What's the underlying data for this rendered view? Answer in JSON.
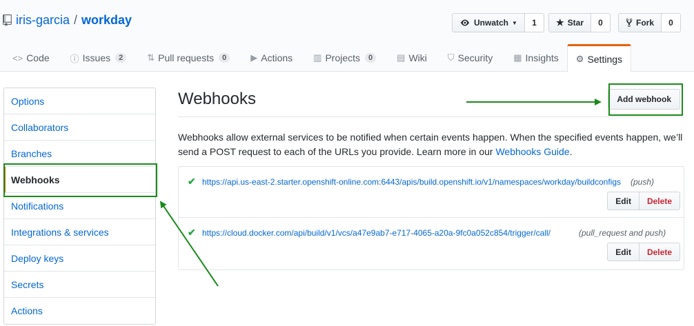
{
  "repo": {
    "owner": "iris-garcia",
    "separator": "/",
    "name": "workday"
  },
  "actions": {
    "watch": {
      "label": "Unwatch",
      "count": "1"
    },
    "star": {
      "label": "Star",
      "count": "0"
    },
    "fork": {
      "label": "Fork",
      "count": "0"
    }
  },
  "tabs": [
    {
      "icon": "code-icon",
      "label": "Code"
    },
    {
      "icon": "issue-icon",
      "label": "Issues",
      "count": "2"
    },
    {
      "icon": "pull-request-icon",
      "label": "Pull requests",
      "count": "0"
    },
    {
      "icon": "play-icon",
      "label": "Actions"
    },
    {
      "icon": "project-icon",
      "label": "Projects",
      "count": "0"
    },
    {
      "icon": "book-icon",
      "label": "Wiki"
    },
    {
      "icon": "shield-icon",
      "label": "Security"
    },
    {
      "icon": "graph-icon",
      "label": "Insights"
    },
    {
      "icon": "gear-icon",
      "label": "Settings"
    }
  ],
  "sidebar": {
    "items": [
      {
        "label": "Options"
      },
      {
        "label": "Collaborators"
      },
      {
        "label": "Branches"
      },
      {
        "label": "Webhooks"
      },
      {
        "label": "Notifications"
      },
      {
        "label": "Integrations & services"
      },
      {
        "label": "Deploy keys"
      },
      {
        "label": "Secrets"
      },
      {
        "label": "Actions"
      }
    ],
    "selected": "Webhooks"
  },
  "main": {
    "title": "Webhooks",
    "add_button": "Add webhook",
    "description_1": "Webhooks allow external services to be notified when certain events happen. When the specified events happen, we’ll send a POST request to each of the URLs you provide. Learn more in our ",
    "description_link": "Webhooks Guide",
    "description_2": ".",
    "hooks": [
      {
        "url": "https://api.us-east-2.starter.openshift-online.com:6443/apis/build.openshift.io/v1/namespaces/workday/buildconfigs",
        "events": "(push)",
        "edit": "Edit",
        "delete": "Delete"
      },
      {
        "url": "https://cloud.docker.com/api/build/v1/vcs/a47e9ab7-e717-4065-a20a-9fc0a052c854/trigger/call/",
        "events": "(pull_request and push)",
        "edit": "Edit",
        "delete": "Delete"
      }
    ]
  },
  "colors": {
    "link": "#0366d6",
    "accent": "#e36209",
    "success": "#28a745",
    "danger": "#cb2431",
    "annotation": "#1a8a1a"
  }
}
